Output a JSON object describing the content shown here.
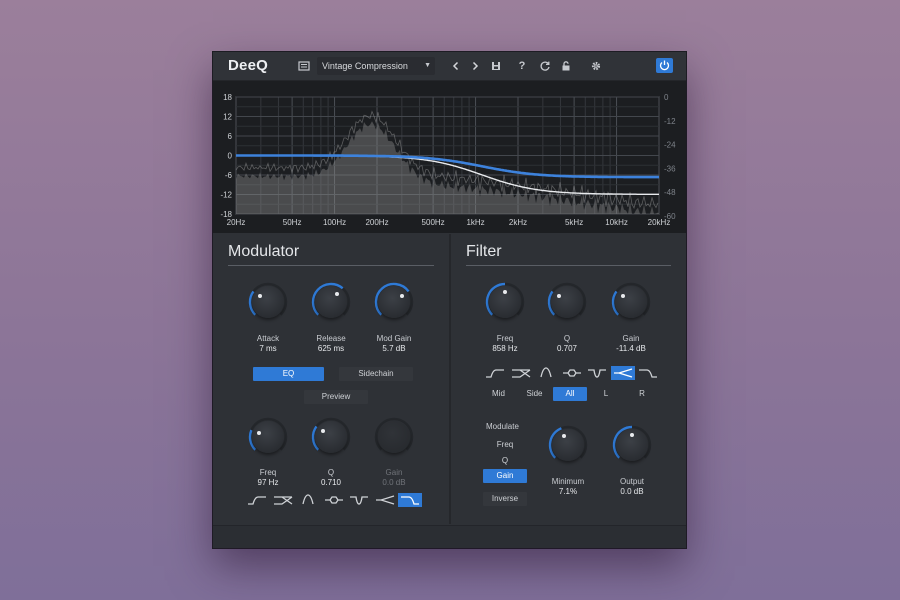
{
  "app": {
    "title": "DeeQ"
  },
  "toolbar": {
    "preset_name": "Vintage Compression",
    "help_label": "?"
  },
  "graph": {
    "left_axis_ticks": [
      "18",
      "12",
      "6",
      "0",
      "-6",
      "-12",
      "-18"
    ],
    "right_axis_ticks": [
      "0",
      "-12",
      "-24",
      "-36",
      "-48",
      "-60"
    ],
    "freq_ticks": [
      "20Hz",
      "50Hz",
      "100Hz",
      "200Hz",
      "500Hz",
      "1kHz",
      "2kHz",
      "5kHz",
      "10kHz",
      "20kHz"
    ]
  },
  "modulator": {
    "title": "Modulator",
    "attack": {
      "label": "Attack",
      "value": "7 ms",
      "level": 0.3
    },
    "release": {
      "label": "Release",
      "value": "625 ms",
      "level": 0.65
    },
    "mod_gain": {
      "label": "Mod Gain",
      "value": "5.7 dB",
      "level": 0.7
    },
    "tab_eq": "EQ",
    "tab_sidechain": "Sidechain",
    "preview": "Preview",
    "freq": {
      "label": "Freq",
      "value": "97 Hz",
      "level": 0.25
    },
    "q": {
      "label": "Q",
      "value": "0.710",
      "level": 0.3
    },
    "gain": {
      "label": "Gain",
      "value": "0.0 dB",
      "level": 0.5
    },
    "selected_shape_index": 6
  },
  "filter": {
    "title": "Filter",
    "freq": {
      "label": "Freq",
      "value": "858 Hz",
      "level": 0.5
    },
    "q": {
      "label": "Q",
      "value": "0.707",
      "level": 0.3
    },
    "gain": {
      "label": "Gain",
      "value": "-11.4 dB",
      "level": 0.3
    },
    "selected_shape_index": 5,
    "channels": [
      "Mid",
      "Side",
      "All",
      "L",
      "R"
    ],
    "selected_channel": "All",
    "modulate_label": "Modulate",
    "modulate_options": [
      "Freq",
      "Q",
      "Gain"
    ],
    "selected_modulate": "Gain",
    "inverse": "Inverse",
    "minimum": {
      "label": "Minimum",
      "value": "7.1%",
      "level": 0.42
    },
    "output": {
      "label": "Output",
      "value": "0.0 dB",
      "level": 0.5
    }
  },
  "colors": {
    "accent": "#2f7ad6",
    "background_top": "#9b7f9b",
    "panel": "#2e3136",
    "graph_bg": "#1c1e21"
  },
  "icons": [
    "list-icon",
    "caret-down-icon",
    "chevron-left-icon",
    "chevron-right-icon",
    "save-icon",
    "help-icon",
    "refresh-icon",
    "lock-icon",
    "gear-icon",
    "power-icon"
  ]
}
